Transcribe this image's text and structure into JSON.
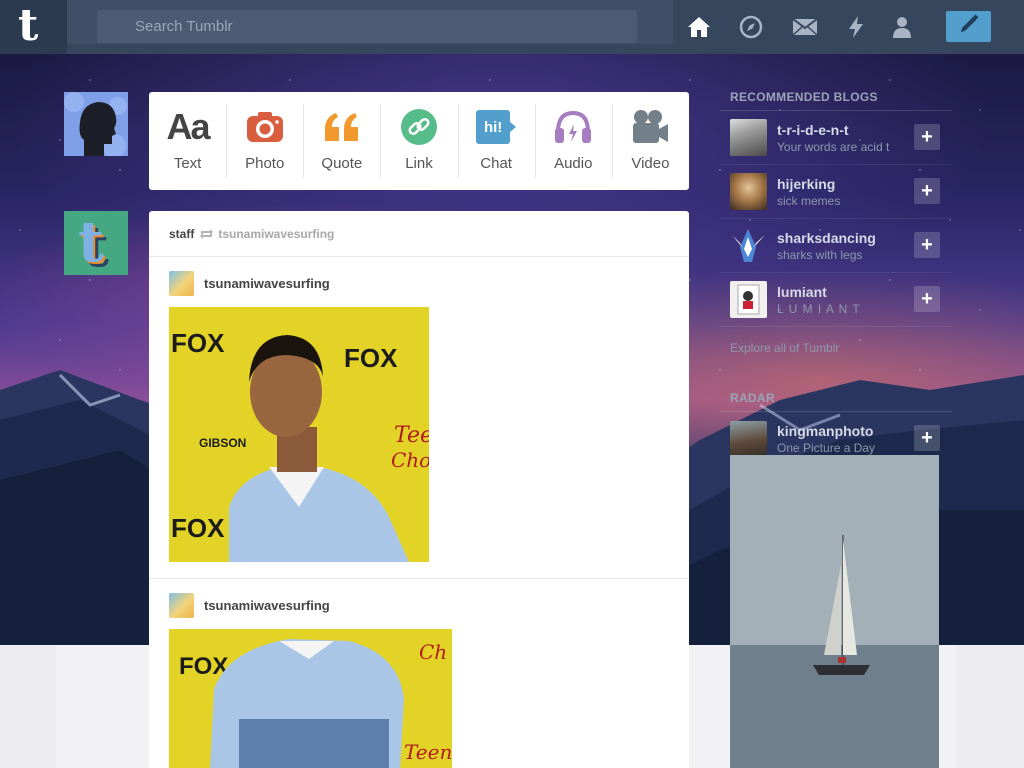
{
  "header": {
    "logo": "t",
    "search_placeholder": "Search Tumblr",
    "nav_icons": [
      "home-icon",
      "explore-icon",
      "inbox-icon",
      "activity-icon",
      "account-icon"
    ],
    "compose_icon": "pencil-icon"
  },
  "post_types": [
    {
      "label": "Text",
      "icon": "Aa",
      "color": "#444444"
    },
    {
      "label": "Photo",
      "icon": "camera",
      "color": "#d95e40"
    },
    {
      "label": "Quote",
      "icon": "quote",
      "color": "#f2992e"
    },
    {
      "label": "Link",
      "icon": "link",
      "color": "#56bc8a"
    },
    {
      "label": "Chat",
      "icon": "hi!",
      "color": "#529ecc"
    },
    {
      "label": "Audio",
      "icon": "headphones",
      "color": "#a77dc2"
    },
    {
      "label": "Video",
      "icon": "video-camera",
      "color": "#748089"
    }
  ],
  "post": {
    "author": "staff",
    "reblogged_from": "tsunamiwavesurfing",
    "entries": [
      {
        "blog": "tsunamiwavesurfing"
      },
      {
        "blog": "tsunamiwavesurfing"
      }
    ]
  },
  "sidebar": {
    "recommended_title": "RECOMMENDED BLOGS",
    "blogs": [
      {
        "name": "t-r-i-d-e-n-t",
        "desc": "Your words are acid t"
      },
      {
        "name": "hijerking",
        "desc": "sick memes"
      },
      {
        "name": "sharksdancing",
        "desc": "sharks with legs"
      },
      {
        "name": "lumiant",
        "desc": "L U M I A N T"
      }
    ],
    "explore_label": "Explore all of Tumblr",
    "radar_title": "RADAR",
    "radar_blog": {
      "name": "kingmanphoto",
      "desc": "One Picture a Day"
    }
  },
  "colors": {
    "header_bg": "#36465d",
    "compose_blue": "#529ecc"
  }
}
